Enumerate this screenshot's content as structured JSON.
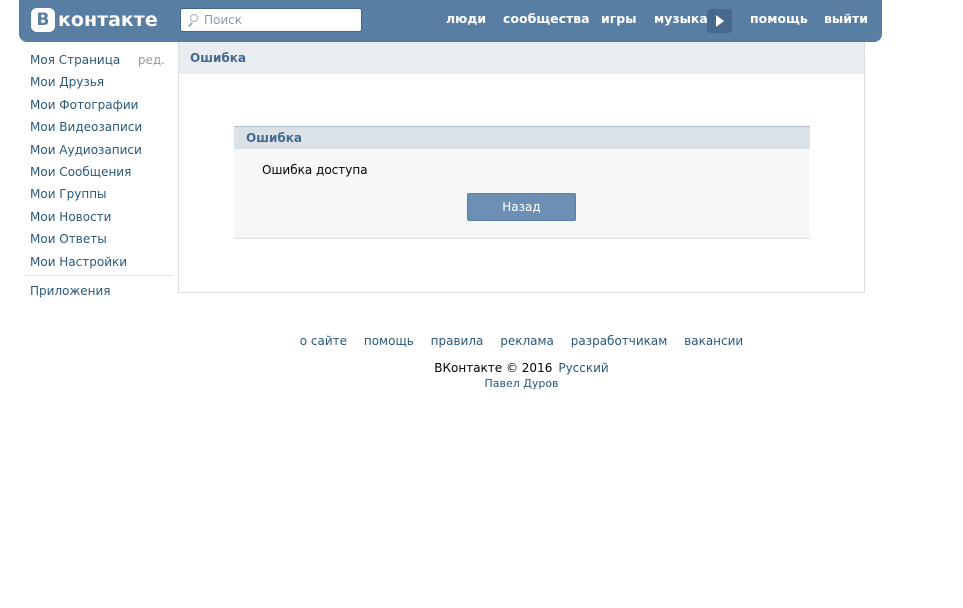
{
  "header": {
    "logo_letter": "В",
    "logo_text": "контакте",
    "search_placeholder": "Поиск",
    "nav": {
      "people": "люди",
      "communities": "сообщества",
      "games": "игры",
      "music": "музыка",
      "help": "помощь",
      "logout": "выйти"
    }
  },
  "sidebar": {
    "edit_label": "ред.",
    "items": [
      "Моя Страница",
      "Мои Друзья",
      "Мои Фотографии",
      "Мои Видеозаписи",
      "Мои Аудиозаписи",
      "Мои Сообщения",
      "Мои Группы",
      "Мои Новости",
      "Мои Ответы",
      "Мои Настройки"
    ],
    "apps": "Приложения"
  },
  "content": {
    "title": "Ошибка",
    "error_box": {
      "title": "Ошибка",
      "message": "Ошибка доступа",
      "back_button": "Назад"
    }
  },
  "footer": {
    "links": [
      "о сайте",
      "помощь",
      "правила",
      "реклама",
      "разработчикам",
      "вакансии"
    ],
    "copyright": "ВКонтакте © 2016",
    "language": "Русский",
    "author": "Павел Дуров"
  },
  "colors": {
    "header_bg": "#587ea3",
    "link": "#2b587a",
    "button_bg": "#6d8fb3",
    "title_text": "#45688e"
  }
}
